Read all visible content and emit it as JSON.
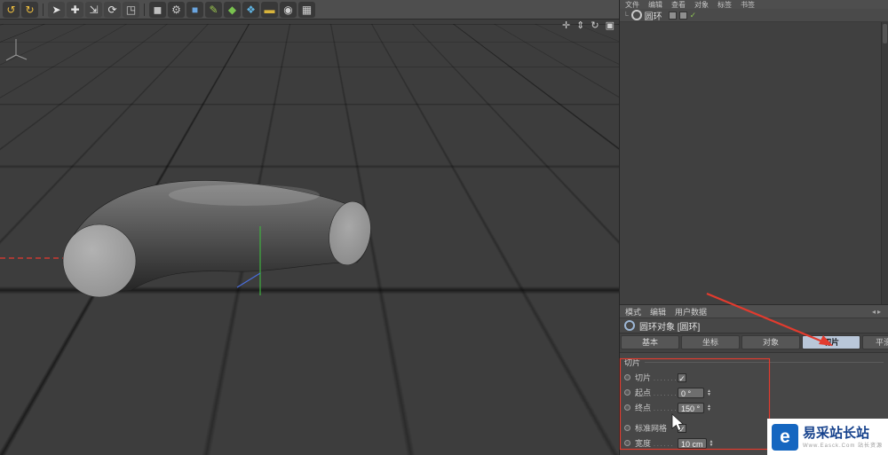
{
  "toolbar": {
    "icons": [
      {
        "name": "undo-icon",
        "glyph": "↺",
        "fg": "#f0c040",
        "bg": "#383838"
      },
      {
        "name": "redo-icon",
        "glyph": "↻",
        "fg": "#f0c040",
        "bg": "#383838"
      },
      {
        "name": "select-tool-icon",
        "glyph": "➤",
        "fg": "#e6e6e6",
        "bg": "#444444"
      },
      {
        "name": "move-tool-icon",
        "glyph": "✚",
        "fg": "#e6e6e6",
        "bg": "#444444"
      },
      {
        "name": "scale-tool-icon",
        "glyph": "⇲",
        "fg": "#e6e6e6",
        "bg": "#444444"
      },
      {
        "name": "rotate-tool-icon",
        "glyph": "⟳",
        "fg": "#e6e6e6",
        "bg": "#444444"
      },
      {
        "name": "coordinate-system-icon",
        "glyph": "◳",
        "fg": "#cfcfcf",
        "bg": "#444444"
      },
      {
        "name": "render-view-icon",
        "glyph": "◼",
        "fg": "#bfbfbf",
        "bg": "#383838"
      },
      {
        "name": "render-settings-icon",
        "glyph": "⚙",
        "fg": "#c9c9c9",
        "bg": "#383838"
      },
      {
        "name": "primitive-cube-icon",
        "glyph": "■",
        "fg": "#6aa5e0",
        "bg": "#383838"
      },
      {
        "name": "spline-pen-icon",
        "glyph": "✎",
        "fg": "#9ac54e",
        "bg": "#383838"
      },
      {
        "name": "generator-icon",
        "glyph": "◆",
        "fg": "#79c24f",
        "bg": "#383838"
      },
      {
        "name": "deformer-icon",
        "glyph": "❖",
        "fg": "#5fb2e0",
        "bg": "#383838"
      },
      {
        "name": "environment-icon",
        "glyph": "▬",
        "fg": "#d8b43c",
        "bg": "#383838"
      },
      {
        "name": "camera-icon",
        "glyph": "◉",
        "fg": "#cfcfcf",
        "bg": "#383838"
      },
      {
        "name": "display-mode-icon",
        "glyph": "▦",
        "fg": "#cfcfcf",
        "bg": "#383838"
      }
    ]
  },
  "viewport": {
    "nav_icons": [
      {
        "name": "viewport-pan-icon",
        "glyph": "✛"
      },
      {
        "name": "viewport-zoom-icon",
        "glyph": "⇕"
      },
      {
        "name": "viewport-rotate-icon",
        "glyph": "↻"
      },
      {
        "name": "viewport-maximize-icon",
        "glyph": "▣"
      }
    ]
  },
  "object_manager": {
    "menu": [
      "文件",
      "编辑",
      "查看",
      "对象",
      "标签",
      "书签"
    ],
    "object_name": "圆环"
  },
  "attributes": {
    "menu": [
      "模式",
      "编辑",
      "用户数据"
    ],
    "title": "圆环对象 [圆环]",
    "tabs": [
      "基本",
      "坐标",
      "对象",
      "切片",
      "平滑着色"
    ],
    "active_tab": 3,
    "section": "切片",
    "rows": [
      {
        "key": "slice",
        "label": "切片",
        "leader": ". . . . . . .",
        "type": "check",
        "checked": true
      },
      {
        "key": "start",
        "label": "起点",
        "leader": ". . . . . . .",
        "type": "value",
        "value": "0 °",
        "spinner": true
      },
      {
        "key": "end",
        "label": "终点",
        "leader": ". . . . . . .",
        "type": "value",
        "value": "150 °",
        "spinner": true
      },
      {
        "key": "regular_grid",
        "label": "标准网格",
        "leader": "",
        "type": "check",
        "checked": true,
        "gap": true
      },
      {
        "key": "width",
        "label": "宽度",
        "leader": ". . . . . .",
        "type": "value",
        "value": "10 cm",
        "spinner": true
      }
    ]
  },
  "annotation": {
    "color": "#e23b2e"
  },
  "watermark": {
    "logo_letter": "e",
    "title": "易采站长站",
    "subtitle": "Www.Easck.Com 站长资源"
  }
}
